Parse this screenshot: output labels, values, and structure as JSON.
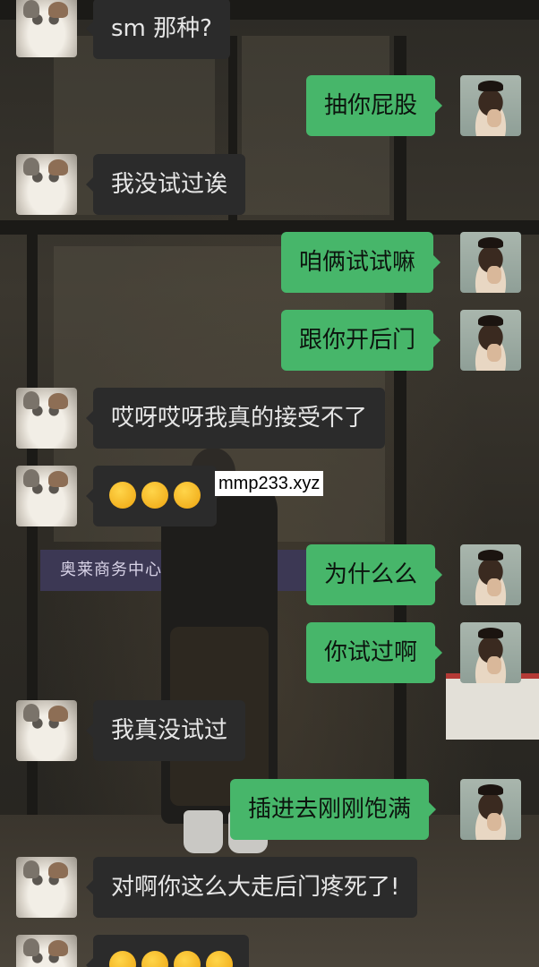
{
  "messages": [
    {
      "sender": "left",
      "text": "sm 那种?"
    },
    {
      "sender": "right",
      "text": "抽你屁股"
    },
    {
      "sender": "left",
      "text": "我没试过诶"
    },
    {
      "sender": "right",
      "text": "咱俩试试嘛"
    },
    {
      "sender": "right",
      "text": "跟你开后门"
    },
    {
      "sender": "left",
      "text": "哎呀哎呀我真的接受不了"
    },
    {
      "sender": "left",
      "emoji": "tired-face-emoji",
      "emoji_count": 3
    },
    {
      "sender": "right",
      "text": "为什么么"
    },
    {
      "sender": "right",
      "text": "你试过啊"
    },
    {
      "sender": "left",
      "text": "我真没试过"
    },
    {
      "sender": "right",
      "text": "插进去刚刚饱满"
    },
    {
      "sender": "left",
      "text": "对啊你这么大走后门疼死了!"
    },
    {
      "sender": "left",
      "emoji": "tired-face-emoji",
      "emoji_count": 4
    }
  ],
  "watermark": "mmp233.xyz",
  "background": {
    "sign_text": "奥莱商务中心"
  },
  "colors": {
    "bubble_left": "#2b2b2b",
    "bubble_right": "#47b66a",
    "text_left": "#e6e6e6",
    "text_right": "#0c140e"
  }
}
